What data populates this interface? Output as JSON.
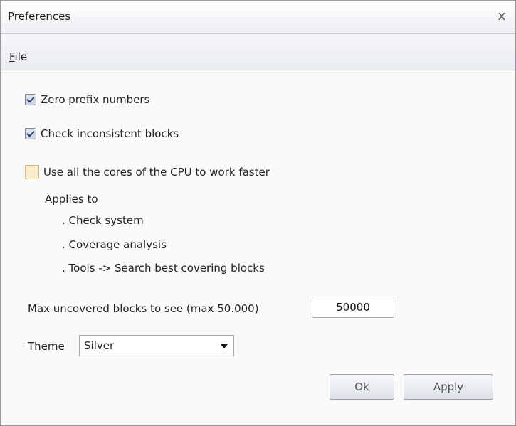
{
  "window": {
    "title": "Preferences",
    "close_label": "x"
  },
  "menu": {
    "file_label": "File",
    "file_mnemonic": "F",
    "file_rest": "ile"
  },
  "options": {
    "zero_prefix": {
      "label": "Zero prefix numbers",
      "checked": true
    },
    "inconsistent": {
      "label": "Check inconsistent blocks",
      "checked": true
    },
    "cores": {
      "label": "Use all the cores of the CPU to work faster",
      "checked": false
    }
  },
  "applies": {
    "heading": "Applies to",
    "items": [
      ". Check system",
      ". Coverage analysis",
      ". Tools -> Search best covering blocks"
    ]
  },
  "max_blocks": {
    "label": "Max uncovered blocks to see (max 50.000)",
    "value": "50000"
  },
  "theme": {
    "label": "Theme",
    "selected": "Silver"
  },
  "buttons": {
    "ok": "Ok",
    "apply": "Apply"
  }
}
